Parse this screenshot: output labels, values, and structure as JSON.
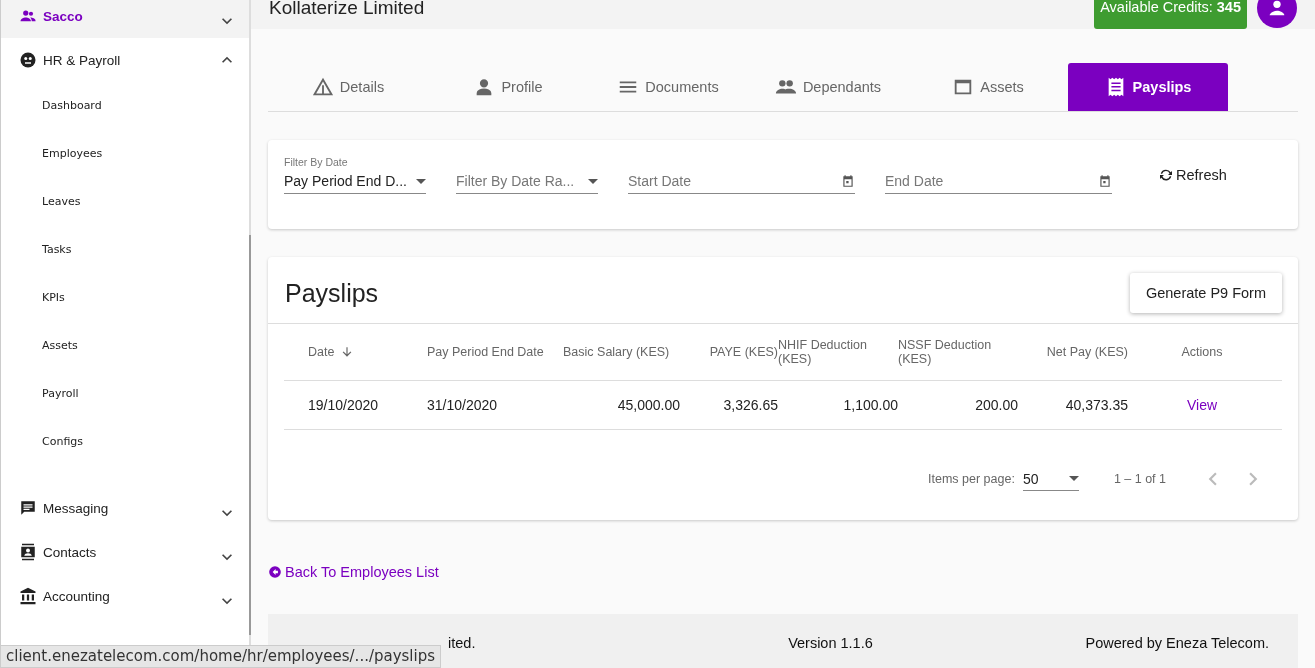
{
  "sidebar": {
    "items": [
      {
        "label": "Sacco",
        "selected": true,
        "expanded": false
      },
      {
        "label": "HR & Payroll",
        "selected": false,
        "expanded": true,
        "children": [
          {
            "label": "Dashboard"
          },
          {
            "label": "Employees"
          },
          {
            "label": "Leaves"
          },
          {
            "label": "Tasks"
          },
          {
            "label": "KPIs"
          },
          {
            "label": "Assets"
          },
          {
            "label": "Payroll"
          },
          {
            "label": "Configs"
          }
        ]
      },
      {
        "label": "Messaging",
        "selected": false,
        "expanded": false
      },
      {
        "label": "Contacts",
        "selected": false,
        "expanded": false
      },
      {
        "label": "Accounting",
        "selected": false,
        "expanded": false
      }
    ]
  },
  "header": {
    "title": "Kollaterize Limited",
    "credits_label": "Available Credits:",
    "credits_value": "345"
  },
  "tabs": [
    {
      "label": "Details",
      "selected": false
    },
    {
      "label": "Profile",
      "selected": false
    },
    {
      "label": "Documents",
      "selected": false
    },
    {
      "label": "Dependants",
      "selected": false
    },
    {
      "label": "Assets",
      "selected": false
    },
    {
      "label": "Payslips",
      "selected": true
    }
  ],
  "filters": {
    "filter_by_date": {
      "label": "Filter By Date",
      "value": "Pay Period End D..."
    },
    "date_range": {
      "placeholder": "Filter By Date Ra..."
    },
    "start_date": {
      "placeholder": "Start Date"
    },
    "end_date": {
      "placeholder": "End Date"
    },
    "refresh": "Refresh"
  },
  "payslips": {
    "title": "Payslips",
    "generate_button": "Generate P9 Form",
    "table": {
      "columns": [
        {
          "label": "Date",
          "sorted": true
        },
        {
          "label": "Pay Period End Date",
          "sorted": false
        },
        {
          "label": "Basic Salary (KES)",
          "sorted": false
        },
        {
          "label": "PAYE (KES)",
          "sorted": false
        },
        {
          "label": "NHIF Deduction (KES)",
          "sorted": false
        },
        {
          "label": "NSSF Deduction (KES)",
          "sorted": false
        },
        {
          "label": "Net Pay (KES)",
          "sorted": false
        },
        {
          "label": "Actions",
          "sorted": false
        }
      ],
      "rows": [
        {
          "cells": [
            "19/10/2020",
            "31/10/2020",
            "45,000.00",
            "3,326.65",
            "1,100.00",
            "200.00",
            "40,373.35"
          ],
          "action": "View"
        }
      ]
    },
    "paginator": {
      "label": "Items per page:",
      "page_size": "50",
      "range": "1 – 1 of 1"
    }
  },
  "back_link": "Back To Employees List",
  "footer": {
    "copyright": "ited.",
    "version": "Version 1.1.6",
    "powered_by": "Powered by Eneza Telecom."
  },
  "status_url": "client.enezatelecom.com/home/hr/employees/.../payslips"
}
